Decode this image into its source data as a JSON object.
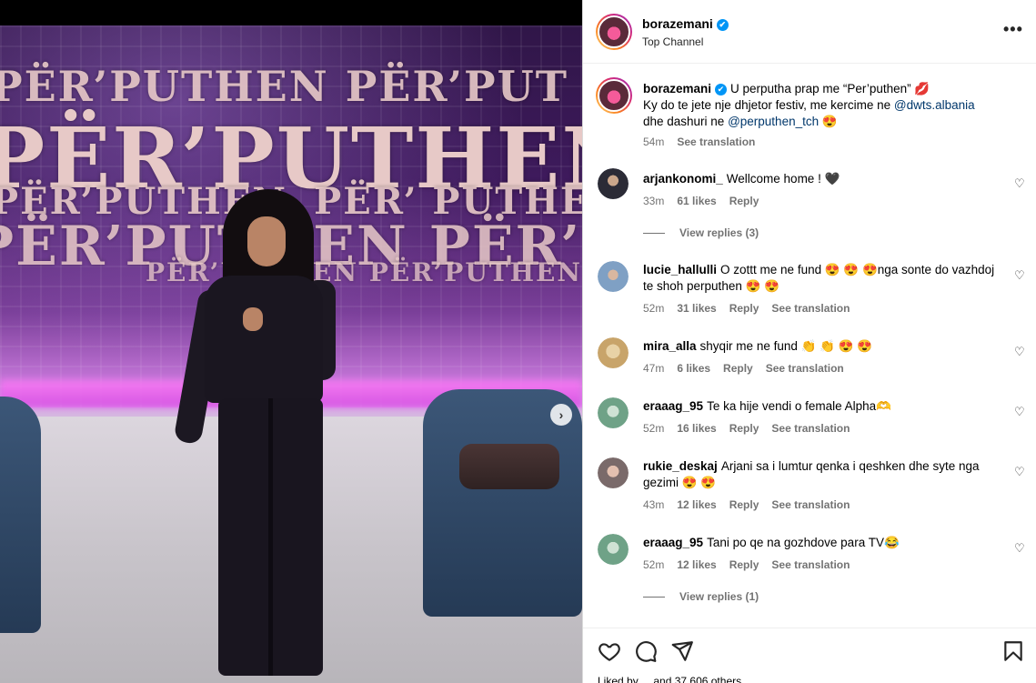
{
  "post": {
    "username": "borazemani",
    "verified_glyph": "✔",
    "location": "Top Channel",
    "more_glyph": "•••",
    "caption": {
      "line1": "U perputha prap me “Per’puthen” 💋",
      "line2_pre": "Ky do te jete nje dhjetor festiv, me kercime ne ",
      "mention1": "@dwts.albania",
      "line2_mid": " dhe dashuri ne ",
      "mention2": "@perputhen_tch",
      "line2_post": " 😍",
      "time": "54m",
      "translate": "See translation"
    },
    "media": {
      "word1": "PËR’PUTHEN PËR’PUT",
      "word2": "PËR’PUTHEN",
      "word3": "PËR’PUTHEN, PËR’ PUTHEN",
      "word4": "PËR’PUTHEN PËR’PUT",
      "word5": "PËR’PUTHEN PËR’PUTHEN",
      "next_glyph": "›"
    }
  },
  "comments": [
    {
      "user": "arjankonomi_",
      "text": "Wellcome home ! 🖤",
      "time": "33m",
      "likes": "61 likes",
      "reply": "Reply",
      "translate": ""
    },
    {
      "user": "lucie_hallulli",
      "text": "O zottt me ne fund 😍 😍 😍nga sonte do vazhdoj te shoh perputhen 😍 😍",
      "time": "52m",
      "likes": "31 likes",
      "reply": "Reply",
      "translate": "See translation"
    },
    {
      "user": "mira_alla",
      "text": "shyqir me ne fund 👏 👏 😍 😍",
      "time": "47m",
      "likes": "6 likes",
      "reply": "Reply",
      "translate": "See translation"
    },
    {
      "user": "eraaag_95",
      "text": "Te ka hije vendi o female Alpha🫶",
      "time": "52m",
      "likes": "16 likes",
      "reply": "Reply",
      "translate": "See translation"
    },
    {
      "user": "rukie_deskaj",
      "text": "Arjani sa i lumtur qenka i qeshken dhe syte nga gezimi 😍 😍",
      "time": "43m",
      "likes": "12 likes",
      "reply": "Reply",
      "translate": "See translation"
    },
    {
      "user": "eraaag_95",
      "text": "Tani po qe na gozhdove para TV😂",
      "time": "52m",
      "likes": "12 likes",
      "reply": "Reply",
      "translate": "See translation"
    }
  ],
  "view_replies": [
    "View replies (3)",
    "View replies (1)"
  ],
  "liked_by": "Liked by ... and 37,606 others",
  "icons": [
    "heart-icon",
    "comment-icon",
    "share-icon",
    "save-icon",
    "more-icon",
    "verified-icon"
  ],
  "colors": {
    "accent": "#0095f6",
    "link": "#00376b",
    "muted": "#737373"
  }
}
